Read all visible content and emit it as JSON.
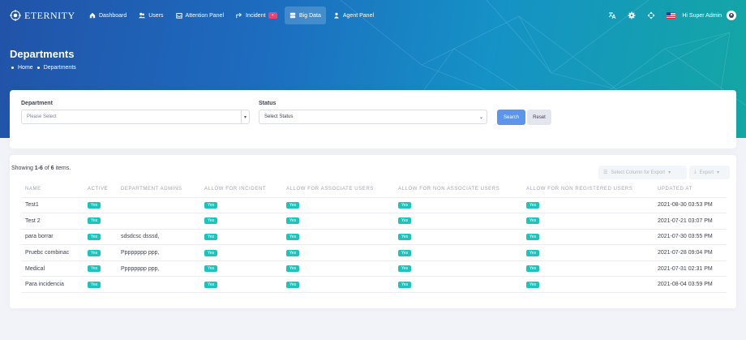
{
  "brand": {
    "name": "ETERNITY"
  },
  "nav": [
    {
      "label": "Dashboard",
      "icon": "home-icon"
    },
    {
      "label": "Users",
      "icon": "users-icon"
    },
    {
      "label": "Attention Panel",
      "icon": "inbox-icon"
    },
    {
      "label": "Incident",
      "icon": "share-icon",
      "badge": ""
    },
    {
      "label": "Big Data",
      "icon": "database-icon",
      "active": true
    },
    {
      "label": "Agent Panel",
      "icon": "agent-icon"
    }
  ],
  "header": {
    "greeting": "Hi Super Admin"
  },
  "page": {
    "title": "Departments",
    "breadcrumb": [
      "Home",
      "Departments"
    ]
  },
  "filters": {
    "department_label": "Department",
    "department_placeholder": "Please Select",
    "status_label": "Status",
    "status_value": "Select Status",
    "search_label": "Search",
    "reset_label": "Reset"
  },
  "table": {
    "summary_prefix": "Showing ",
    "summary_range": "1-6",
    "summary_mid": " of ",
    "summary_total": "6",
    "summary_suffix": " items.",
    "select_columns_label": "Select Column for Export",
    "export_label": "Export",
    "headers": [
      "NAME",
      "ACTIVE",
      "DEPARTMENT ADMINS",
      "ALLOW FOR INCIDENT",
      "ALLOW FOR ASSOCIATE USERS",
      "ALLOW FOR NON ASSOCIATE USERS",
      "ALLOW FOR NON REGISTERED USERS",
      "UPDATED AT"
    ],
    "rows": [
      {
        "name": "Test1",
        "active": "Yes",
        "admins": "",
        "incident": "Yes",
        "assoc": "Yes",
        "nonassoc": "Yes",
        "nonreg": "Yes",
        "updated": "2021-08-30 03:53 PM"
      },
      {
        "name": "Test 2",
        "active": "Yes",
        "admins": "",
        "incident": "Yes",
        "assoc": "Yes",
        "nonassoc": "Yes",
        "nonreg": "Yes",
        "updated": "2021-07-21 03:07 PM"
      },
      {
        "name": "para borrar",
        "active": "Yes",
        "admins": "sdsdcsc dsssd,",
        "incident": "Yes",
        "assoc": "Yes",
        "nonassoc": "Yes",
        "nonreg": "Yes",
        "updated": "2021-07-30 03:55 PM"
      },
      {
        "name": "Pruebc combinac",
        "active": "Yes",
        "admins": "Pppppppp ppp,",
        "incident": "Yes",
        "assoc": "Yes",
        "nonassoc": "Yes",
        "nonreg": "Yes",
        "updated": "2021-07-28 09:04 PM"
      },
      {
        "name": "Medical",
        "active": "Yes",
        "admins": "Pppppppp ppp,",
        "incident": "Yes",
        "assoc": "Yes",
        "nonassoc": "Yes",
        "nonreg": "Yes",
        "updated": "2021-07-31 02:31 PM"
      },
      {
        "name": "Para incidencia",
        "active": "Yes",
        "admins": "",
        "incident": "Yes",
        "assoc": "Yes",
        "nonassoc": "Yes",
        "nonreg": "Yes",
        "updated": "2021-08-04 03:59 PM"
      }
    ]
  },
  "colors": {
    "accent": "#5d95ea",
    "success": "#1bc5bd",
    "danger": "#f1416c"
  }
}
